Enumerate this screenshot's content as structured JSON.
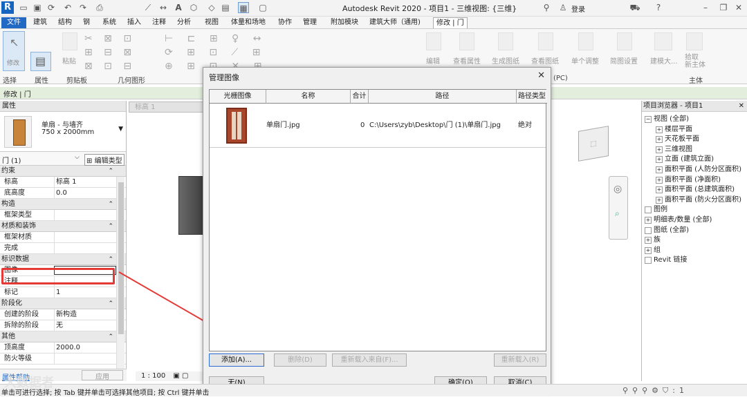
{
  "app": {
    "logo": "R",
    "title": "Autodesk Revit 2020 - 项目1 - 三维视图: {三维}",
    "signin": "登录"
  },
  "tabs": [
    "文件",
    "建筑",
    "结构",
    "钢",
    "系统",
    "插入",
    "注释",
    "分析",
    "视图",
    "体量和场地",
    "协作",
    "管理",
    "附加模块",
    "建筑大师（通用)",
    "修改 | 门"
  ],
  "ribbon": {
    "select": "选择",
    "modify": "修改",
    "properties": "属性",
    "paste": "粘贴",
    "clipboard": "剪贴板",
    "geometry": "几何图形",
    "edit": "编辑",
    "view_props": "查看属性",
    "gen_sheet": "生成图纸",
    "view_sheet": "查看图纸",
    "adjust": "单个调整",
    "sheet_settings": "简图设置",
    "pc": "(PC)",
    "builder": "建模大...",
    "host": "拾取\n新主体",
    "host_group": "主体"
  },
  "ctx": "修改 | 门",
  "properties": {
    "header": "属性",
    "type_name": "单扇 - 与墙齐",
    "type_size": "750 x 2000mm",
    "instance": "门 (1)",
    "edit_type": "编辑类型",
    "rows": [
      {
        "kind": "cat",
        "label": "约束"
      },
      {
        "kind": "row",
        "k": "标高",
        "v": "标高 1"
      },
      {
        "kind": "row",
        "k": "底高度",
        "v": "0.0"
      },
      {
        "kind": "cat",
        "label": "构造"
      },
      {
        "kind": "row",
        "k": "框架类型",
        "v": ""
      },
      {
        "kind": "cat",
        "label": "材质和装饰"
      },
      {
        "kind": "row",
        "k": "框架材质",
        "v": ""
      },
      {
        "kind": "row",
        "k": "完成",
        "v": ""
      },
      {
        "kind": "cat",
        "label": "标识数据"
      },
      {
        "kind": "row",
        "k": "图像",
        "v": ""
      },
      {
        "kind": "row",
        "k": "注释",
        "v": ""
      },
      {
        "kind": "row",
        "k": "标记",
        "v": "1"
      },
      {
        "kind": "cat",
        "label": "阶段化"
      },
      {
        "kind": "row",
        "k": "创建的阶段",
        "v": "新构造"
      },
      {
        "kind": "row",
        "k": "拆除的阶段",
        "v": "无"
      },
      {
        "kind": "cat",
        "label": "其他"
      },
      {
        "kind": "row",
        "k": "顶高度",
        "v": "2000.0"
      },
      {
        "kind": "row",
        "k": "防火等级",
        "v": ""
      }
    ],
    "help": "属性帮助",
    "apply": "应用"
  },
  "view": {
    "tab": "标高 1",
    "scale": "1 : 100"
  },
  "dialog": {
    "title": "管理图像",
    "cols": [
      "光栅图像",
      "名称",
      "合计",
      "路径",
      "路径类型"
    ],
    "row": {
      "name": "单扇门.jpg",
      "count": "0",
      "path": "C:\\Users\\zyb\\Desktop\\门 (1)\\单扇门.jpg",
      "path_type": "绝对"
    },
    "add": "添加(A)...",
    "delete": "删除(D)",
    "reload_from": "重新载入来自(F)...",
    "reload": "重新载入(R)",
    "none": "无(N)",
    "ok": "确定(O)",
    "cancel": "取消(C)"
  },
  "browser": {
    "title": "项目浏览器 - 项目1",
    "items": [
      {
        "label": "视图 (全部)",
        "indent": 0,
        "tog": "−"
      },
      {
        "label": "楼层平面",
        "indent": 1,
        "tog": "+"
      },
      {
        "label": "天花板平面",
        "indent": 1,
        "tog": "+"
      },
      {
        "label": "三维视图",
        "indent": 1,
        "tog": "+"
      },
      {
        "label": "立面 (建筑立面)",
        "indent": 1,
        "tog": "+"
      },
      {
        "label": "面积平面 (人防分区面积)",
        "indent": 1,
        "tog": "+"
      },
      {
        "label": "面积平面 (净面积)",
        "indent": 1,
        "tog": "+"
      },
      {
        "label": "面积平面 (总建筑面积)",
        "indent": 1,
        "tog": "+"
      },
      {
        "label": "面积平面 (防火分区面积)",
        "indent": 1,
        "tog": "+"
      },
      {
        "label": "图例",
        "indent": 0,
        "tog": ""
      },
      {
        "label": "明细表/数量 (全部)",
        "indent": 0,
        "tog": "+"
      },
      {
        "label": "图纸 (全部)",
        "indent": 0,
        "tog": ""
      },
      {
        "label": "族",
        "indent": 0,
        "tog": "+"
      },
      {
        "label": "组",
        "indent": 0,
        "tog": "+"
      },
      {
        "label": "Revit 链接",
        "indent": 0,
        "tog": ""
      }
    ]
  },
  "status": "单击可进行选择; 按 Tab 键并单击可选择其他项目; 按 Ctrl 键并单击",
  "watermark": "大数据者",
  "colors": {
    "accent": "#2169c4",
    "highlight": "#e53935",
    "door": "#b5502a"
  }
}
